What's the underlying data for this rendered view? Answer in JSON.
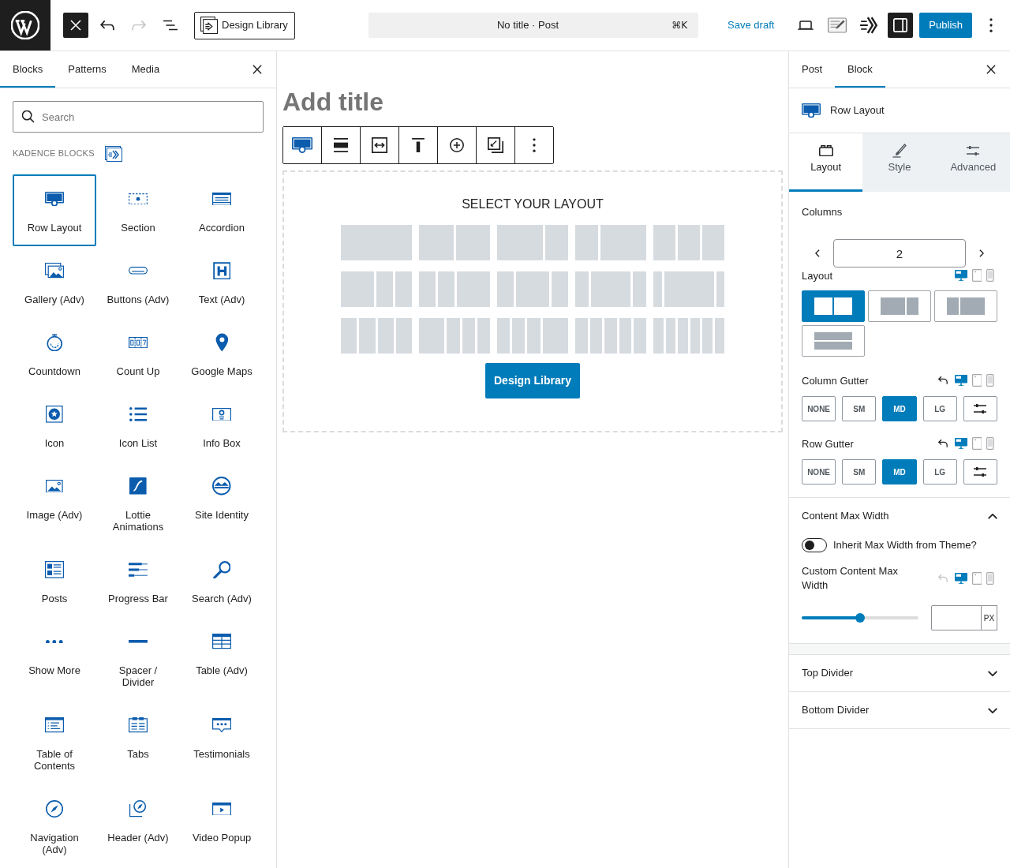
{
  "topbar": {
    "tools_left": [
      {
        "kind": "inserter-close",
        "pressed": true,
        "disabled": false
      },
      {
        "kind": "undo",
        "pressed": false,
        "disabled": false
      },
      {
        "kind": "redo",
        "pressed": false,
        "disabled": true
      },
      {
        "kind": "list-view",
        "pressed": false,
        "disabled": false
      }
    ],
    "library_button": "Design Library",
    "command": {
      "title": "No title · Post",
      "shortcut": "⌘K"
    },
    "save_draft": "Save draft",
    "tools_right": [
      {
        "kind": "preview",
        "pressed": false
      },
      {
        "kind": "notes",
        "pressed": false
      },
      {
        "kind": "logo-mark",
        "pressed": false
      },
      {
        "kind": "settings",
        "pressed": true
      }
    ],
    "publish": "Publish"
  },
  "inserter": {
    "tabs": [
      {
        "label": "Blocks",
        "selected": true
      },
      {
        "label": "Patterns",
        "selected": false
      },
      {
        "label": "Media",
        "selected": false
      }
    ],
    "search": {
      "placeholder": "Search"
    },
    "category": "KADENCE BLOCKS",
    "blocks": [
      {
        "label": "Row Layout",
        "kind": "row-layout",
        "selected": true
      },
      {
        "label": "Section",
        "kind": "section",
        "selected": false
      },
      {
        "label": "Accordion",
        "kind": "accordion",
        "selected": false
      },
      {
        "label": "Gallery (Adv)",
        "kind": "gallery",
        "selected": false
      },
      {
        "label": "Buttons (Adv)",
        "kind": "buttons",
        "selected": false
      },
      {
        "label": "Text (Adv)",
        "kind": "text",
        "selected": false
      },
      {
        "label": "Countdown",
        "kind": "countdown",
        "selected": false
      },
      {
        "label": "Count Up",
        "kind": "count-up",
        "selected": false
      },
      {
        "label": "Google Maps",
        "kind": "map",
        "selected": false
      },
      {
        "label": "Icon",
        "kind": "icon",
        "selected": false
      },
      {
        "label": "Icon List",
        "kind": "icon-list",
        "selected": false
      },
      {
        "label": "Info Box",
        "kind": "info-box",
        "selected": false
      },
      {
        "label": "Image (Adv)",
        "kind": "image",
        "selected": false
      },
      {
        "label": "Lottie Animations",
        "kind": "lottie",
        "selected": false
      },
      {
        "label": "Site Identity",
        "kind": "site-identity",
        "selected": false
      },
      {
        "label": "Posts",
        "kind": "posts",
        "selected": false
      },
      {
        "label": "Progress Bar",
        "kind": "progress-bar",
        "selected": false
      },
      {
        "label": "Search (Adv)",
        "kind": "search",
        "selected": false
      },
      {
        "label": "Show More",
        "kind": "show-more",
        "selected": false
      },
      {
        "label": "Spacer / Divider",
        "kind": "spacer",
        "selected": false
      },
      {
        "label": "Table (Adv)",
        "kind": "table",
        "selected": false
      },
      {
        "label": "Table of Contents",
        "kind": "toc",
        "selected": false
      },
      {
        "label": "Tabs",
        "kind": "tabs",
        "selected": false
      },
      {
        "label": "Testimonials",
        "kind": "testimonials",
        "selected": false
      },
      {
        "label": "Navigation (Adv)",
        "kind": "navigation",
        "selected": false
      },
      {
        "label": "Header (Adv)",
        "kind": "header",
        "selected": false
      },
      {
        "label": "Video Popup",
        "kind": "video-popup",
        "selected": false
      }
    ]
  },
  "editor": {
    "title_placeholder": "Add title",
    "toolbar": [
      {
        "kind": "row-layout"
      },
      {
        "kind": "align"
      },
      {
        "kind": "width"
      },
      {
        "kind": "valign-top"
      },
      {
        "kind": "add"
      },
      {
        "kind": "copy-style"
      },
      {
        "kind": "more"
      }
    ],
    "layout_picker": {
      "heading": "SELECT YOUR LAYOUT",
      "button": "Design Library"
    }
  },
  "sidebar": {
    "tabs": [
      {
        "label": "Post",
        "selected": false
      },
      {
        "label": "Block",
        "selected": true
      }
    ],
    "block": {
      "kind": "row-layout",
      "name": "Row Layout"
    },
    "panel_tabs": [
      {
        "label": "Layout",
        "kind": "layout",
        "selected": true
      },
      {
        "label": "Style",
        "kind": "style",
        "selected": false
      },
      {
        "label": "Advanced",
        "kind": "advanced",
        "selected": false
      }
    ],
    "columns": {
      "label": "Columns",
      "value": "2"
    },
    "layout": {
      "label": "Layout",
      "devices": [
        {
          "kind": "desktop",
          "selected": true
        },
        {
          "kind": "tablet",
          "selected": false
        },
        {
          "kind": "mobile",
          "selected": false
        }
      ],
      "options": [
        {
          "kind": "equal",
          "selected": true
        },
        {
          "kind": "left-wide",
          "selected": false
        },
        {
          "kind": "right-wide",
          "selected": false
        },
        {
          "kind": "stacked",
          "selected": false
        }
      ]
    },
    "column_gutter": {
      "label": "Column Gutter",
      "reset": {
        "disabled": false
      },
      "devices": [
        {
          "kind": "desktop",
          "selected": true
        },
        {
          "kind": "tablet",
          "selected": false
        },
        {
          "kind": "mobile",
          "selected": false
        }
      ],
      "options": [
        {
          "kind": "preset",
          "label": "NONE",
          "selected": false
        },
        {
          "kind": "preset",
          "label": "SM",
          "selected": false
        },
        {
          "kind": "preset",
          "label": "MD",
          "selected": true
        },
        {
          "kind": "preset",
          "label": "LG",
          "selected": false
        },
        {
          "kind": "custom",
          "selected": false
        }
      ]
    },
    "row_gutter": {
      "label": "Row Gutter",
      "reset": {
        "disabled": false
      },
      "devices": [
        {
          "kind": "desktop",
          "selected": true
        },
        {
          "kind": "tablet",
          "selected": false
        },
        {
          "kind": "mobile",
          "selected": false
        }
      ],
      "options": [
        {
          "kind": "preset",
          "label": "NONE",
          "selected": false
        },
        {
          "kind": "preset",
          "label": "SM",
          "selected": false
        },
        {
          "kind": "preset",
          "label": "MD",
          "selected": true
        },
        {
          "kind": "preset",
          "label": "LG",
          "selected": false
        },
        {
          "kind": "custom",
          "selected": false
        }
      ]
    },
    "sections": [
      {
        "title": "Content Max Width",
        "expanded": true,
        "toggle": {
          "label": "Inherit Max Width from Theme?",
          "on": false
        },
        "max_width": {
          "label": "Custom Content Max Width",
          "reset": {
            "disabled": true
          },
          "devices": [
            {
              "kind": "desktop",
              "selected": true
            },
            {
              "kind": "tablet",
              "selected": false
            },
            {
              "kind": "mobile",
              "selected": false
            }
          ],
          "slider": {
            "level": 0.5
          },
          "unit": "PX"
        }
      },
      {
        "title": "Top Divider",
        "expanded": false
      },
      {
        "title": "Bottom Divider",
        "expanded": false
      }
    ]
  }
}
